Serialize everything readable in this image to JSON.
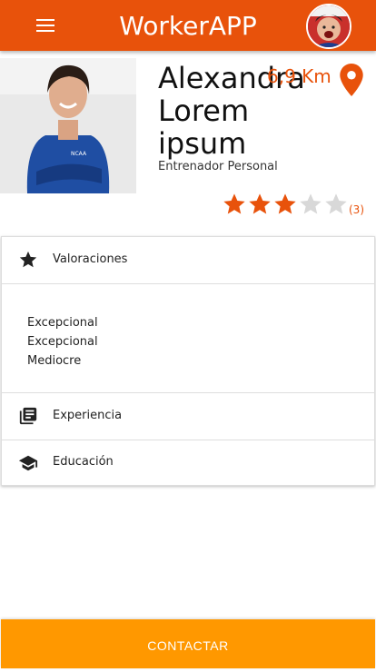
{
  "app": {
    "title": "WorkerAPP",
    "accent": "#e8520b",
    "button_color": "#ff9800"
  },
  "profile": {
    "name": "Alexandra Lorem ipsum",
    "role": "Entrenador Personal",
    "distance": "6,9 Km",
    "rating": 3,
    "rating_max": 5,
    "rating_count": "(3)"
  },
  "sections": {
    "reviews_label": "Valoraciones",
    "reviews": [
      "Excepcional",
      "Excepcional",
      "Mediocre"
    ],
    "experience_label": "Experiencia",
    "education_label": "Educación"
  },
  "actions": {
    "contact_label": "CONTACTAR"
  },
  "icons": {
    "menu": "menu-icon",
    "location": "location-pin-icon",
    "star": "star-icon",
    "experience": "library-books-icon",
    "education": "school-icon"
  }
}
